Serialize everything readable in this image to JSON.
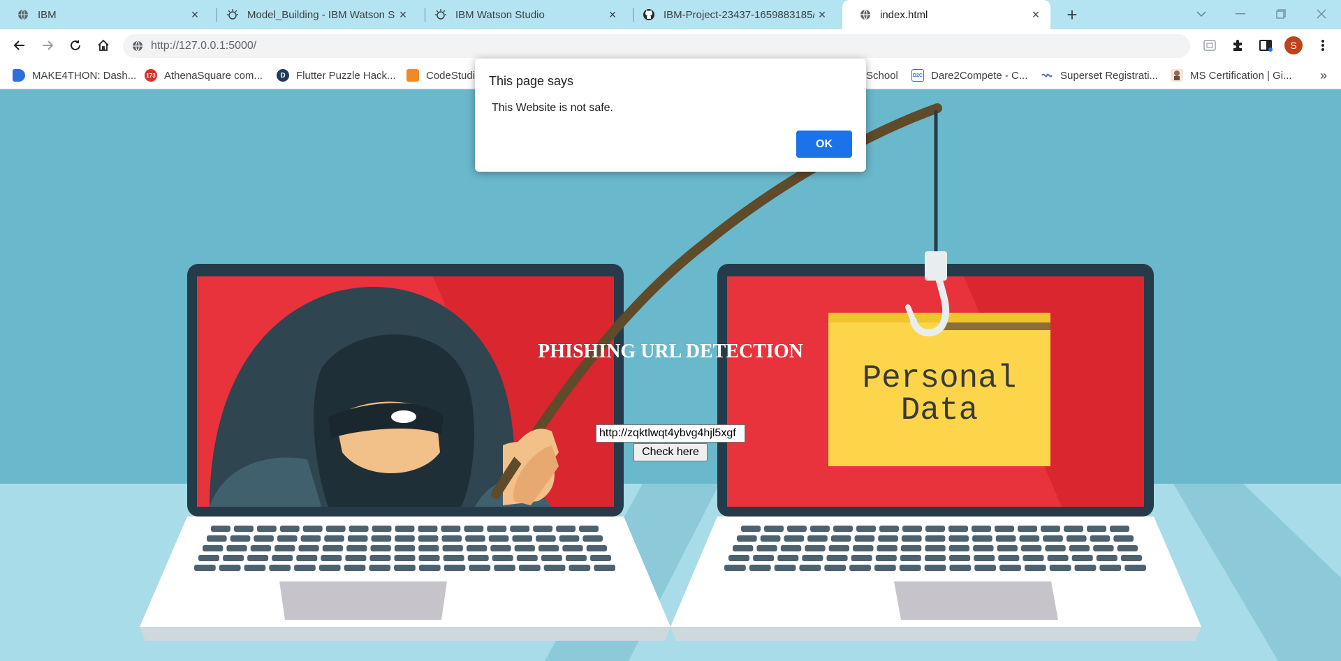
{
  "tabs": [
    {
      "title": "IBM",
      "icon": "globe-icon"
    },
    {
      "title": "Model_Building - IBM Watson Stu",
      "icon": "watson-icon"
    },
    {
      "title": "IBM Watson Studio",
      "icon": "watson-icon"
    },
    {
      "title": "IBM-Project-23437-1659883185/",
      "icon": "github-icon"
    },
    {
      "title": "index.html",
      "icon": "globe-icon",
      "active": true
    }
  ],
  "toolbar": {
    "url": "http://127.0.0.1:5000/",
    "profile_initial": "S"
  },
  "bookmarks": [
    {
      "label": "MAKE4THON: Dash...",
      "color": "#2f6fdc"
    },
    {
      "label": "AthenaSquare com...",
      "color": "#d93025",
      "icon_text": "173"
    },
    {
      "label": "Flutter Puzzle Hack...",
      "color": "#1f3b5c",
      "icon_text": "D"
    },
    {
      "label": "CodeStudi",
      "color": "#f08a24"
    },
    {
      "label": "School",
      "color": ""
    },
    {
      "label": "Dare2Compete - C...",
      "color": "#2f6fdc",
      "icon_text": "D2C"
    },
    {
      "label": "Superset Registrati...",
      "color": "#5b6bd6"
    },
    {
      "label": "MS Certification | Gi...",
      "color": "#8d6e63"
    }
  ],
  "page": {
    "heading": "PHISHING URL DETECTION",
    "subheading": "PHISHING URL DETECTION",
    "url_input_value": "http://zqktlwqt4ybvg4hjl5xgf",
    "check_button": "Check here",
    "folder_text_line1": "Personal",
    "folder_text_line2": "Data"
  },
  "dialog": {
    "title": "This page says",
    "message": "This Website is not safe.",
    "ok_label": "OK"
  },
  "colors": {
    "tabstrip": "#b4e3f1",
    "page_background": "#6ab8cc",
    "screen_red": "#e8323c",
    "folder_yellow": "#fcd54a",
    "accent_blue": "#1a73e8"
  }
}
